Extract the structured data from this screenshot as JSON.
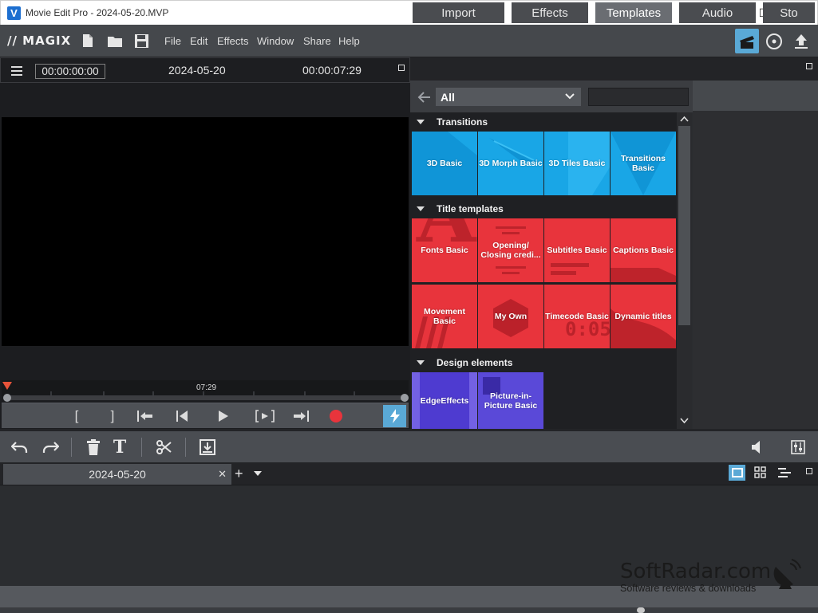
{
  "window": {
    "title": "Movie Edit Pro - 2024-05-20.MVP",
    "controls": {
      "minimize": "—",
      "maximize": "☐",
      "close": "✕"
    }
  },
  "menubar": {
    "logo": "// MAGIX",
    "menus": [
      "File",
      "Edit",
      "Effects",
      "Window",
      "Share",
      "Help"
    ]
  },
  "preview": {
    "timecode_current": "00:00:00:00",
    "project_name": "2024-05-20",
    "timecode_total": "00:00:07:29",
    "ruler_mark": "07:29",
    "transport": {
      "in_mark": "[",
      "out_mark": "]"
    }
  },
  "media_pool": {
    "tabs": [
      "Import",
      "Effects",
      "Templates",
      "Audio",
      "Sto"
    ],
    "active_tab": "Templates",
    "filter_value": "All",
    "sections": [
      {
        "title": "Transitions",
        "tiles": [
          "3D Basic",
          "3D Morph Basic",
          "3D Tiles Basic",
          "Transitions Basic"
        ]
      },
      {
        "title": "Title templates",
        "tiles": [
          "Fonts Basic",
          "Opening/ Closing credi...",
          "Subtitles Basic",
          "Captions Basic",
          "Movement Basic",
          "My Own",
          "Timecode Basic",
          "Dynamic titles"
        ]
      },
      {
        "title": "Design elements",
        "tiles": [
          "EdgeEffects",
          "Picture-in-Picture Basic"
        ]
      }
    ],
    "tile_decor": {
      "fonts_letter": "A",
      "timecode_digits": "0:05"
    }
  },
  "timeline": {
    "tab_name": "2024-05-20",
    "add_tab": "+"
  },
  "watermark": {
    "main": "SoftRadar.com",
    "sub": "Software reviews & downloads"
  },
  "colors": {
    "transition_tile": "#19a6e6",
    "title_tile": "#e8343c",
    "design_tile": "#4e3bd0",
    "record": "#e8343c",
    "accent_button": "#5aa9d6"
  }
}
